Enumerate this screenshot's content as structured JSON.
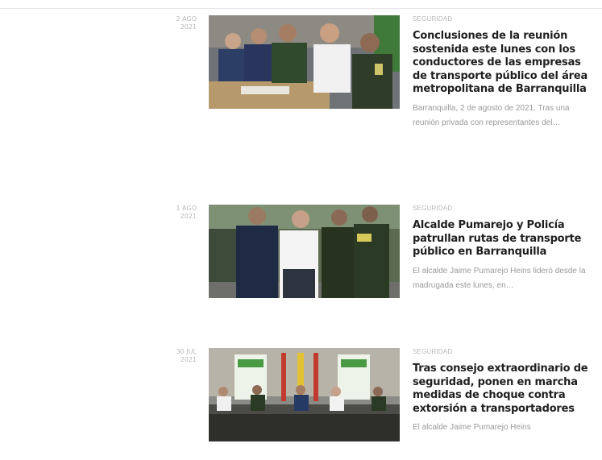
{
  "articles": [
    {
      "date_day": "2 AGO",
      "date_year": "2021",
      "category": "SEGURIDAD",
      "title": "Conclusiones de la reunión sostenida este lunes con los conductores de las empresas de transporte público del área metropolitana de Barranquilla",
      "excerpt": "Barranquilla, 2 de agosto de 2021. Tras una reunión privada con representantes del…"
    },
    {
      "date_day": "1 AGO",
      "date_year": "2021",
      "category": "SEGURIDAD",
      "title": "Alcalde Pumarejo y Policía patrullan rutas de transporte público en Barranquilla",
      "excerpt": "El alcalde Jaime Pumarejo Heins lideró desde la madrugada este lunes, en…"
    },
    {
      "date_day": "30 JUL",
      "date_year": "2021",
      "category": "SEGURIDAD",
      "title": "Tras consejo extraordinario de seguridad, ponen en marcha medidas de choque contra extorsión a transportadores",
      "excerpt": "El alcalde Jaime Pumarejo Heins"
    }
  ],
  "colors": {
    "title": "#1f1f1f",
    "category": "#b8b8b8",
    "excerpt": "#9a9a9a",
    "date": "#b9b9b9"
  }
}
